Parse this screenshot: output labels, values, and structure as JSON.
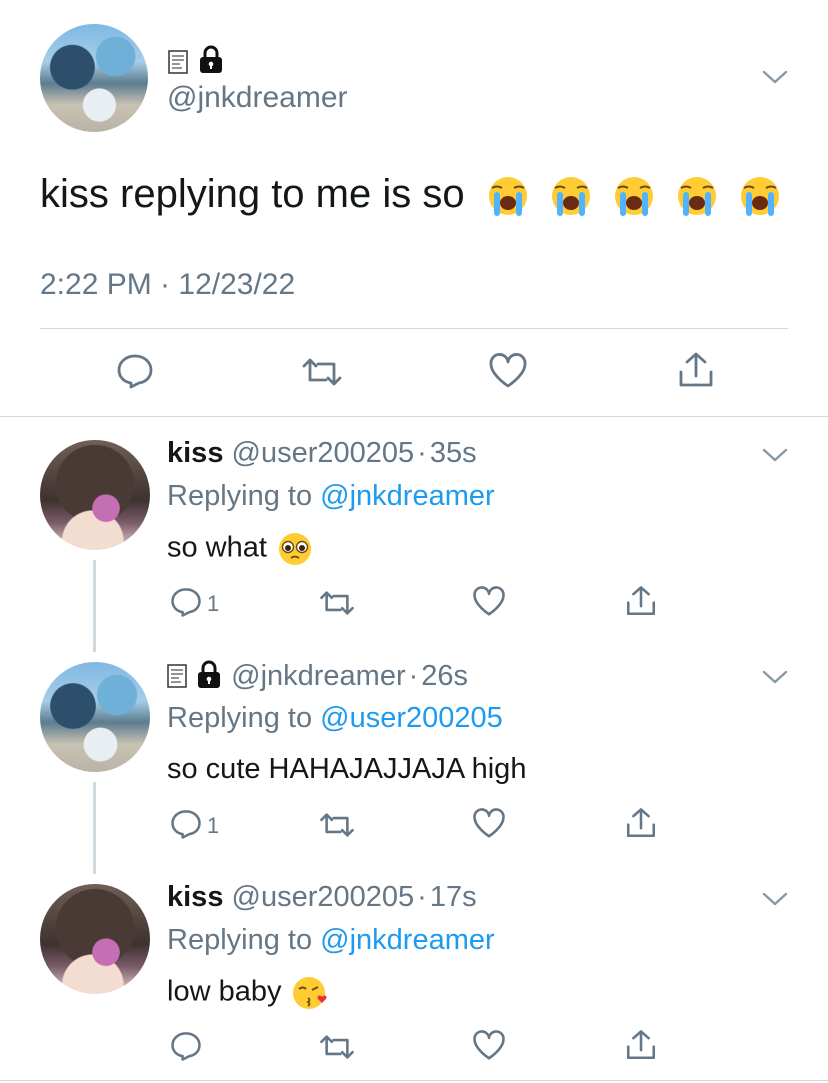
{
  "main_tweet": {
    "handle": "@jnkdreamer",
    "text": "kiss replying to me is so",
    "timestamp": "2:22 PM · 12/23/22"
  },
  "replies": [
    {
      "name": "kiss",
      "handle": "@user200205",
      "time": "35s",
      "replying_to": "@jnkdreamer",
      "text": "so what",
      "reply_count": "1"
    },
    {
      "name": "",
      "handle": "@jnkdreamer",
      "time": "26s",
      "replying_to": "@user200205",
      "text": "so cute HAHAJAJJAJA high",
      "reply_count": "1"
    },
    {
      "name": "kiss",
      "handle": "@user200205",
      "time": "17s",
      "replying_to": "@jnkdreamer",
      "text": "low baby",
      "reply_count": ""
    }
  ],
  "labels": {
    "replying_prefix": "Replying to",
    "dot": "·"
  },
  "colors": {
    "accent": "#1d9bf0",
    "secondary_text": "#657786",
    "divider": "#cfd9de"
  }
}
